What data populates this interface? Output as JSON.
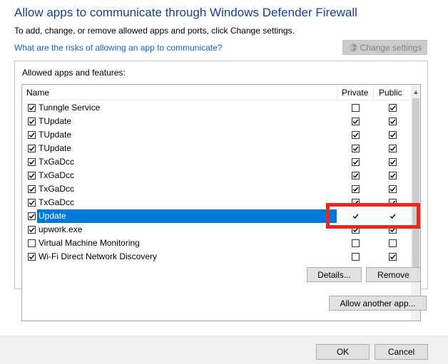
{
  "header": {
    "title": "Allow apps to communicate through Windows Defender Firewall",
    "subtitle": "To add, change, or remove allowed apps and ports, click Change settings.",
    "risk_link": "What are the risks of allowing an app to communicate?",
    "change_settings_label": "Change settings"
  },
  "group": {
    "label": "Allowed apps and features:",
    "columns": {
      "name": "Name",
      "private": "Private",
      "public": "Public"
    },
    "rows": [
      {
        "name": "Tunngle Service",
        "enabled": true,
        "private": false,
        "public": true,
        "selected": false
      },
      {
        "name": "TUpdate",
        "enabled": true,
        "private": true,
        "public": true,
        "selected": false
      },
      {
        "name": "TUpdate",
        "enabled": true,
        "private": true,
        "public": true,
        "selected": false
      },
      {
        "name": "TUpdate",
        "enabled": true,
        "private": true,
        "public": true,
        "selected": false
      },
      {
        "name": "TxGaDcc",
        "enabled": true,
        "private": true,
        "public": true,
        "selected": false
      },
      {
        "name": "TxGaDcc",
        "enabled": true,
        "private": true,
        "public": true,
        "selected": false
      },
      {
        "name": "TxGaDcc",
        "enabled": true,
        "private": true,
        "public": true,
        "selected": false
      },
      {
        "name": "TxGaDcc",
        "enabled": true,
        "private": true,
        "public": true,
        "selected": false
      },
      {
        "name": "Update",
        "enabled": true,
        "private": true,
        "public": true,
        "selected": true
      },
      {
        "name": "upwork.exe",
        "enabled": true,
        "private": true,
        "public": true,
        "selected": false
      },
      {
        "name": "Virtual Machine Monitoring",
        "enabled": false,
        "private": false,
        "public": false,
        "selected": false
      },
      {
        "name": "Wi-Fi Direct Network Discovery",
        "enabled": true,
        "private": false,
        "public": true,
        "selected": false
      }
    ],
    "details_label": "Details...",
    "remove_label": "Remove"
  },
  "allow_another_label": "Allow another app...",
  "footer": {
    "ok_label": "OK",
    "cancel_label": "Cancel"
  },
  "colors": {
    "title": "#1a3e93",
    "link": "#1565c0",
    "selection": "#0078d7",
    "highlight": "#e8281a"
  }
}
